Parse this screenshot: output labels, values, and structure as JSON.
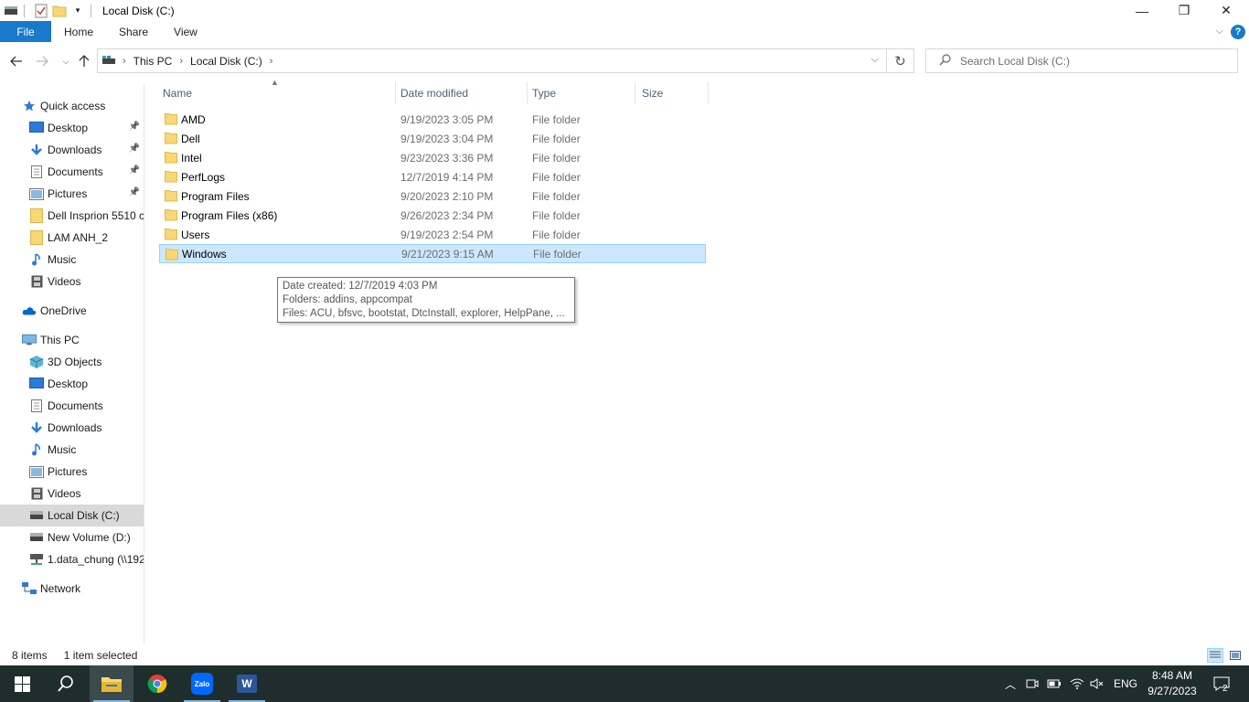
{
  "window": {
    "title": "Local Disk (C:)",
    "controls": {
      "minimize": "—",
      "restore": "❐",
      "close": "✕"
    }
  },
  "ribbon": {
    "file_label": "File",
    "tabs": [
      "Home",
      "Share",
      "View"
    ],
    "help": "?"
  },
  "nav": {
    "breadcrumbs": [
      "This PC",
      "Local Disk (C:)"
    ],
    "search_placeholder": "Search Local Disk (C:)"
  },
  "sidebar": {
    "items": [
      {
        "label": "Quick access",
        "icon": "star-icon",
        "indent": 0
      },
      {
        "label": "Desktop",
        "icon": "desktop-icon",
        "indent": 1,
        "pinned": true
      },
      {
        "label": "Downloads",
        "icon": "download-arrow-icon",
        "indent": 1,
        "pinned": true
      },
      {
        "label": "Documents",
        "icon": "document-icon",
        "indent": 1,
        "pinned": true
      },
      {
        "label": "Pictures",
        "icon": "pictures-icon",
        "indent": 1,
        "pinned": true
      },
      {
        "label": "Dell Insprion 5510 c",
        "icon": "folder-icon",
        "indent": 1
      },
      {
        "label": "LAM ANH_2",
        "icon": "folder-icon",
        "indent": 1
      },
      {
        "label": "Music",
        "icon": "music-note-icon",
        "indent": 1
      },
      {
        "label": "Videos",
        "icon": "film-icon",
        "indent": 1
      },
      {
        "label": "OneDrive",
        "icon": "cloud-icon",
        "indent": 0,
        "gap": true
      },
      {
        "label": "This PC",
        "icon": "computer-icon",
        "indent": 0,
        "gap": true
      },
      {
        "label": "3D Objects",
        "icon": "cube-icon",
        "indent": 1
      },
      {
        "label": "Desktop",
        "icon": "desktop-icon",
        "indent": 1
      },
      {
        "label": "Documents",
        "icon": "document-icon",
        "indent": 1
      },
      {
        "label": "Downloads",
        "icon": "download-arrow-icon",
        "indent": 1
      },
      {
        "label": "Music",
        "icon": "music-note-icon",
        "indent": 1
      },
      {
        "label": "Pictures",
        "icon": "pictures-icon",
        "indent": 1
      },
      {
        "label": "Videos",
        "icon": "film-icon",
        "indent": 1
      },
      {
        "label": "Local Disk (C:)",
        "icon": "drive-icon",
        "indent": 1,
        "selected": true
      },
      {
        "label": "New Volume (D:)",
        "icon": "drive-icon",
        "indent": 1
      },
      {
        "label": "1.data_chung (\\\\192",
        "icon": "network-drive-icon",
        "indent": 1
      },
      {
        "label": "Network",
        "icon": "network-icon",
        "indent": 0,
        "gap": true
      }
    ]
  },
  "columns": {
    "name": "Name",
    "date": "Date modified",
    "type": "Type",
    "size": "Size"
  },
  "files": [
    {
      "name": "AMD",
      "date": "9/19/2023 3:05 PM",
      "type": "File folder"
    },
    {
      "name": "Dell",
      "date": "9/19/2023 3:04 PM",
      "type": "File folder"
    },
    {
      "name": "Intel",
      "date": "9/23/2023 3:36 PM",
      "type": "File folder"
    },
    {
      "name": "PerfLogs",
      "date": "12/7/2019 4:14 PM",
      "type": "File folder"
    },
    {
      "name": "Program Files",
      "date": "9/20/2023 2:10 PM",
      "type": "File folder"
    },
    {
      "name": "Program Files (x86)",
      "date": "9/26/2023 2:34 PM",
      "type": "File folder"
    },
    {
      "name": "Users",
      "date": "9/19/2023 2:54 PM",
      "type": "File folder"
    },
    {
      "name": "Windows",
      "date": "9/21/2023 9:15 AM",
      "type": "File folder",
      "selected": true
    }
  ],
  "tooltip": {
    "line1": "Date created: 12/7/2019 4:03 PM",
    "line2": "Folders: addins, appcompat",
    "line3": "Files: ACU, bfsvc, bootstat, DtcInstall, explorer, HelpPane, ..."
  },
  "status": {
    "count": "8 items",
    "selection": "1 item selected"
  },
  "taskbar": {
    "language": "ENG",
    "time": "8:48 AM",
    "date": "9/27/2023",
    "notifications": "2",
    "apps": [
      "file-explorer",
      "chrome",
      "zalo",
      "word"
    ],
    "zalo_label": "Zalo",
    "word_label": "W"
  },
  "colors": {
    "accent": "#1979ca",
    "selection": "#cce8ff",
    "taskbar": "#202d2d",
    "folder": "#f8d775"
  }
}
